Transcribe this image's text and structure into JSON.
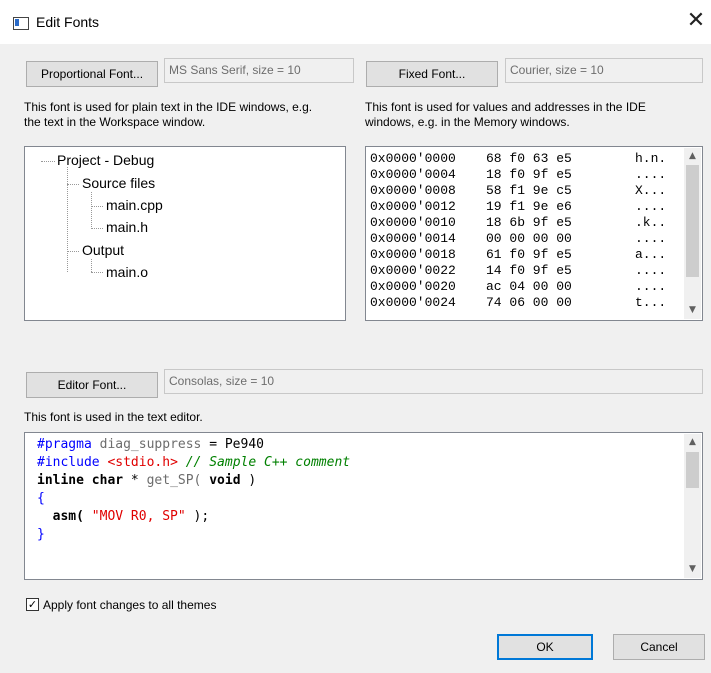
{
  "window": {
    "title": "Edit Fonts",
    "close_glyph": "✕"
  },
  "proportional": {
    "button_label": "Proportional Font...",
    "value": "MS Sans Serif, size = 10",
    "description_line1": "This font is used for plain text in the IDE windows, e.g.",
    "description_line2": "the text in the Workspace window."
  },
  "fixed": {
    "button_label": "Fixed Font...",
    "value": "Courier, size = 10",
    "description_line1": "This font is used for values and addresses in the IDE",
    "description_line2": "windows, e.g. in the Memory windows."
  },
  "tree": {
    "items": [
      {
        "label": "Project - Debug",
        "level": 0
      },
      {
        "label": "Source files",
        "level": 1
      },
      {
        "label": "main.cpp",
        "level": 2
      },
      {
        "label": "main.h",
        "level": 2
      },
      {
        "label": "Output",
        "level": 1
      },
      {
        "label": "main.o",
        "level": 2
      }
    ]
  },
  "memory": {
    "rows": [
      {
        "addr": "0x0000'0000",
        "bytes": "68 f0 63 e5",
        "ascii": "h.n."
      },
      {
        "addr": "0x0000'0004",
        "bytes": "18 f0 9f e5",
        "ascii": "...."
      },
      {
        "addr": "0x0000'0008",
        "bytes": "58 f1 9e c5",
        "ascii": "X..."
      },
      {
        "addr": "0x0000'0012",
        "bytes": "19 f1 9e e6",
        "ascii": "...."
      },
      {
        "addr": "0x0000'0010",
        "bytes": "18 6b 9f e5",
        "ascii": ".k.."
      },
      {
        "addr": "0x0000'0014",
        "bytes": "00 00 00 00",
        "ascii": "...."
      },
      {
        "addr": "0x0000'0018",
        "bytes": "61 f0 9f e5",
        "ascii": "a..."
      },
      {
        "addr": "0x0000'0022",
        "bytes": "14 f0 9f e5",
        "ascii": "...."
      },
      {
        "addr": "0x0000'0020",
        "bytes": "ac 04 00 00",
        "ascii": "...."
      },
      {
        "addr": "0x0000'0024",
        "bytes": "74 06 00 00",
        "ascii": "t..."
      }
    ]
  },
  "editor_font": {
    "button_label": "Editor Font...",
    "value": "Consolas, size = 10",
    "description": "This font is used in the text editor."
  },
  "code": {
    "line1": {
      "kw": "#pragma",
      "rest": " diag_suppress ",
      "eq": "=",
      "val": " Pe940"
    },
    "line2": {
      "kw": "#include",
      "inc": " <stdio.h>",
      "comment": " // Sample C++ comment"
    },
    "line3": {
      "kw1": "inline",
      "kw2": " char",
      "mid": " * ",
      "fn": "get_SP(",
      "kw3": " void",
      "end": " )"
    },
    "line4": {
      "text": "{"
    },
    "line5": {
      "fn": "  asm(",
      "str": " \"MOV R0, SP\"",
      "end": " );"
    },
    "line6": {
      "text": "}"
    }
  },
  "apply": {
    "label": "Apply font changes to all themes",
    "checked": true,
    "check_glyph": "✓"
  },
  "buttons": {
    "ok": "OK",
    "cancel": "Cancel"
  },
  "scroll": {
    "up_glyph": "▲",
    "down_glyph": "▼"
  },
  "colors": {
    "accent": "#0078d7",
    "keyword": "#0000ff",
    "string": "#e00000",
    "comment": "#008000"
  }
}
